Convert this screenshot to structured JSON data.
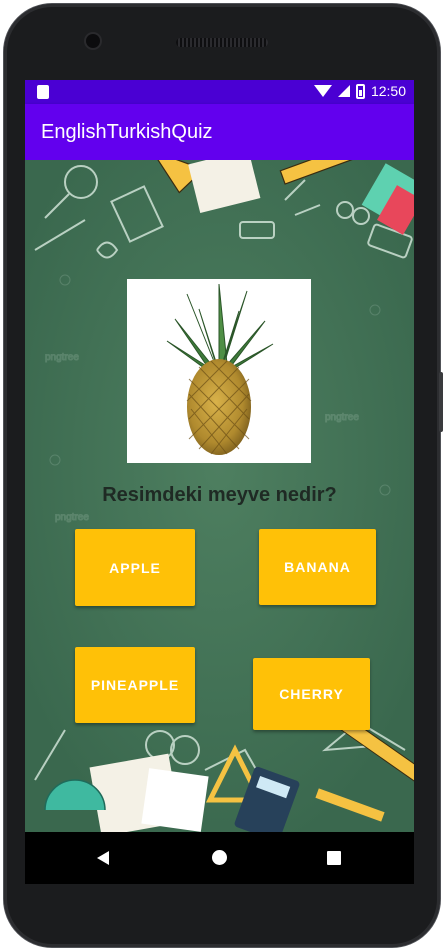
{
  "status_bar": {
    "time": "12:50"
  },
  "app_bar": {
    "title": "EnglishTurkishQuiz"
  },
  "quiz": {
    "question": "Resimdeki meyve nedir?",
    "image_icon": "pineapple-image",
    "options": [
      "APPLE",
      "BANANA",
      "PINEAPPLE",
      "CHERRY"
    ]
  },
  "colors": {
    "status_bar": "#4a00d3",
    "app_bar": "#6200ee",
    "background": "#3f6f54",
    "button": "#ffc107"
  },
  "nav_bar": {
    "icons": [
      "back-icon",
      "home-icon",
      "recents-icon"
    ]
  }
}
